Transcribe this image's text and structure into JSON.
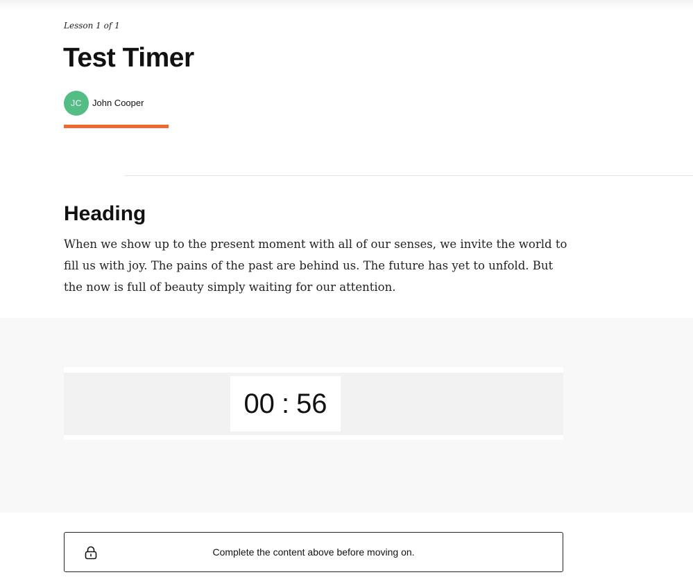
{
  "lesson": {
    "counter": "Lesson 1 of 1",
    "title": "Test Timer",
    "author": {
      "initials": "JC",
      "name": "John Cooper"
    },
    "progress_percent": 100
  },
  "content": {
    "heading": "Heading",
    "paragraph": "When we show up to the present moment with all of our senses, we invite the world to fill us with joy. The pains of the past are behind us. The future has yet to unfold. But the now is full of beauty simply waiting for our attention."
  },
  "timer": {
    "minutes": "00",
    "separator": ":",
    "seconds": "56"
  },
  "continue_notice": {
    "icon": "lock-icon",
    "text": "Complete the content above before moving on."
  },
  "colors": {
    "accent": "#f0672f",
    "avatar": "#54bd85"
  }
}
